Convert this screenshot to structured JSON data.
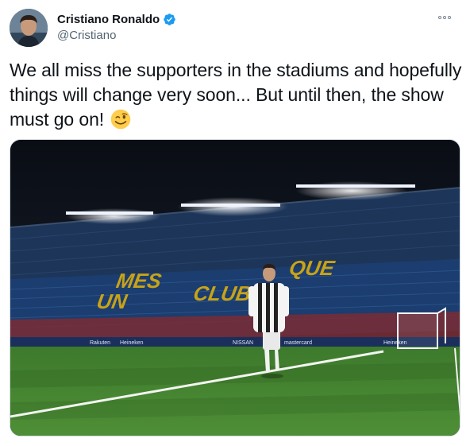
{
  "author": {
    "name": "Cristiano Ronaldo",
    "handle": "@Cristiano",
    "verified": true
  },
  "tweet": {
    "text": "We all miss the supporters in the stadiums and hopefully things will change very soon... But until then, the show must go on!",
    "emoji": "winking-face"
  },
  "media": {
    "stand_lettering": [
      "MES",
      "QUE",
      "UN",
      "CLUB"
    ],
    "ad_boards": [
      "Rakuten",
      "Heineken",
      "NISSAN",
      "mastercard",
      "Heineken"
    ]
  },
  "colors": {
    "verified_blue": "#1d9bf0",
    "handle_gray": "#536471",
    "pitch_green": "#3f7d2a",
    "seat_blue": "#1f3b66"
  }
}
